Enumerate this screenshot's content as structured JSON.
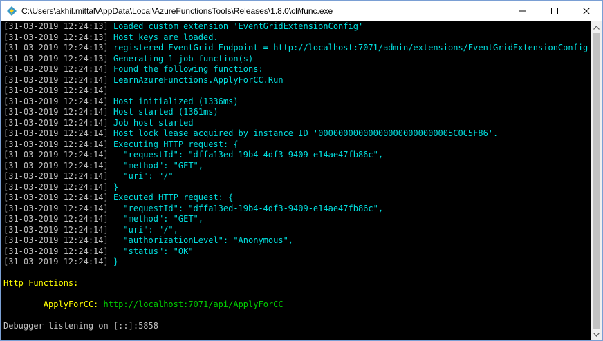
{
  "window": {
    "title": "C:\\Users\\akhil.mittal\\AppData\\Local\\AzureFunctionsTools\\Releases\\1.8.0\\cli\\func.exe"
  },
  "colors": {
    "timestamp": "#c0c0c0",
    "info": "#00e0e0",
    "header": "#ffff00",
    "url": "#00d000"
  },
  "log": {
    "lines": [
      {
        "ts": "[31-03-2019 12:24:13]",
        "msg": " Loaded custom extension 'EventGridExtensionConfig'"
      },
      {
        "ts": "[31-03-2019 12:24:13]",
        "msg": " Host keys are loaded."
      },
      {
        "ts": "[31-03-2019 12:24:13]",
        "msg": " registered EventGrid Endpoint = http://localhost:7071/admin/extensions/EventGridExtensionConfig"
      },
      {
        "ts": "[31-03-2019 12:24:13]",
        "msg": " Generating 1 job function(s)"
      },
      {
        "ts": "[31-03-2019 12:24:14]",
        "msg": " Found the following functions:"
      },
      {
        "ts": "[31-03-2019 12:24:14]",
        "msg": " LearnAzureFunctions.ApplyForCC.Run"
      },
      {
        "ts": "[31-03-2019 12:24:14]",
        "msg": ""
      },
      {
        "ts": "[31-03-2019 12:24:14]",
        "msg": " Host initialized (1336ms)"
      },
      {
        "ts": "[31-03-2019 12:24:14]",
        "msg": " Host started (1361ms)"
      },
      {
        "ts": "[31-03-2019 12:24:14]",
        "msg": " Job host started"
      },
      {
        "ts": "[31-03-2019 12:24:14]",
        "msg": " Host lock lease acquired by instance ID '000000000000000000000000005C0C5F86'."
      },
      {
        "ts": "[31-03-2019 12:24:14]",
        "msg": " Executing HTTP request: {"
      },
      {
        "ts": "[31-03-2019 12:24:14]",
        "msg": "   \"requestId\": \"dffa13ed-19b4-4df3-9409-e14ae47fb86c\","
      },
      {
        "ts": "[31-03-2019 12:24:14]",
        "msg": "   \"method\": \"GET\","
      },
      {
        "ts": "[31-03-2019 12:24:14]",
        "msg": "   \"uri\": \"/\""
      },
      {
        "ts": "[31-03-2019 12:24:14]",
        "msg": " }"
      },
      {
        "ts": "[31-03-2019 12:24:14]",
        "msg": " Executed HTTP request: {"
      },
      {
        "ts": "[31-03-2019 12:24:14]",
        "msg": "   \"requestId\": \"dffa13ed-19b4-4df3-9409-e14ae47fb86c\","
      },
      {
        "ts": "[31-03-2019 12:24:14]",
        "msg": "   \"method\": \"GET\","
      },
      {
        "ts": "[31-03-2019 12:24:14]",
        "msg": "   \"uri\": \"/\","
      },
      {
        "ts": "[31-03-2019 12:24:14]",
        "msg": "   \"authorizationLevel\": \"Anonymous\","
      },
      {
        "ts": "[31-03-2019 12:24:14]",
        "msg": "   \"status\": \"OK\""
      },
      {
        "ts": "[31-03-2019 12:24:14]",
        "msg": " }"
      }
    ],
    "http_header": "Http Functions:",
    "function_name": "        ApplyForCC:",
    "function_url": " http://localhost:7071/api/ApplyForCC",
    "debugger": "Debugger listening on [::]:5858"
  },
  "scrollbar": {
    "position_fraction": 0.0
  }
}
